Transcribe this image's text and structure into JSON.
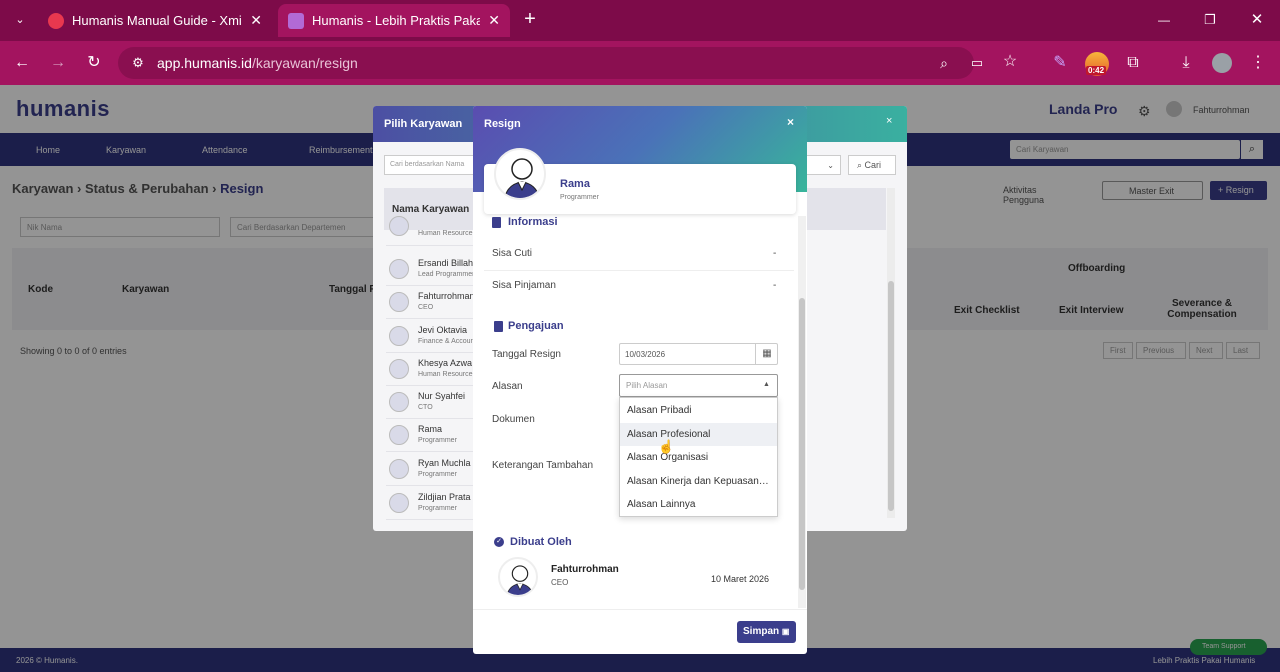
{
  "browser": {
    "tabs": [
      {
        "title": "Humanis Manual Guide - Xmind",
        "close": "✕"
      },
      {
        "title": "Humanis - Lebih Praktis Pakai Humanis",
        "close": "✕"
      }
    ],
    "new_tab": "+",
    "url_host": "app.humanis.id",
    "url_path": "/karyawan/resign",
    "timer_badge": "0:42",
    "window_controls": {
      "minimize": "—",
      "restore": "❐",
      "close": "✕"
    }
  },
  "app": {
    "logo": "humanis",
    "company": "Landa Pro",
    "user": "Fahturrohman",
    "nav": [
      "Home",
      "Karyawan",
      "Attendance",
      "Reimbursement"
    ],
    "search_placeholder": "Cari Karyawan",
    "breadcrumb": [
      "Karyawan",
      "Status & Perubahan",
      "Resign"
    ],
    "buttons": {
      "aktivitas": "Aktivitas Pengguna",
      "master_exit": "Master Exit",
      "resign": "+ Resign"
    },
    "filters": {
      "nama": "Nik Nama",
      "departemen": "Cari Berdasarkan Departemen"
    },
    "table_headers": [
      "Kode",
      "Karyawan",
      "Tanggal R",
      "Offboarding",
      "Exit Checklist",
      "Exit Interview",
      "Severance & Compensation"
    ],
    "showing": "Showing 0 to 0 of 0 entries",
    "pagination": [
      "First",
      "Previous",
      "Next",
      "Last"
    ],
    "footer_left": "2026 © Humanis.",
    "footer_right": "Lebih Praktis Pakai Humanis",
    "support": "Team Support"
  },
  "pilih_modal": {
    "title": "Pilih Karyawan",
    "search_placeholder": "Cari berdasarkan Nama",
    "search_button": "Cari",
    "column": "Nama Karyawan",
    "rows": [
      {
        "name": "",
        "job": "Human Resource"
      },
      {
        "name": "Ersandi Billah",
        "job": "Lead Programmer"
      },
      {
        "name": "Fahturrohman",
        "job": "CEO"
      },
      {
        "name": "Jevi Oktavia",
        "job": "Finance & Accounting"
      },
      {
        "name": "Khesya Azwa",
        "job": "Human Resource"
      },
      {
        "name": "Nur Syahfei",
        "job": "CTO"
      },
      {
        "name": "Rama",
        "job": "Programmer"
      },
      {
        "name": "Ryan Muchla",
        "job": "Programmer"
      },
      {
        "name": "Zildjian Prata",
        "job": "Programmer"
      }
    ]
  },
  "resign_modal": {
    "title": "Resign",
    "close": "×",
    "employee": {
      "name": "Rama",
      "job": "Programmer"
    },
    "informasi": {
      "title": "Informasi",
      "rows": [
        {
          "label": "Sisa Cuti",
          "value": "-"
        },
        {
          "label": "Sisa Pinjaman",
          "value": "-"
        }
      ]
    },
    "pengajuan": {
      "title": "Pengajuan",
      "tanggal_label": "Tanggal Resign",
      "tanggal_value": "10/03/2026",
      "alasan_label": "Alasan",
      "alasan_placeholder": "Pilih Alasan",
      "dokumen_label": "Dokumen",
      "keterangan_label": "Keterangan Tambahan",
      "options": [
        "Alasan Pribadi",
        "Alasan Profesional",
        "Alasan Organisasi",
        "Alasan Kinerja dan Kepuasan Kerja",
        "Alasan Lainnya"
      ],
      "highlighted_option": "Alasan Profesional"
    },
    "dibuat": {
      "title": "Dibuat Oleh",
      "name": "Fahturrohman",
      "job": "CEO",
      "date": "10 Maret 2026"
    },
    "simpan": "Simpan"
  }
}
